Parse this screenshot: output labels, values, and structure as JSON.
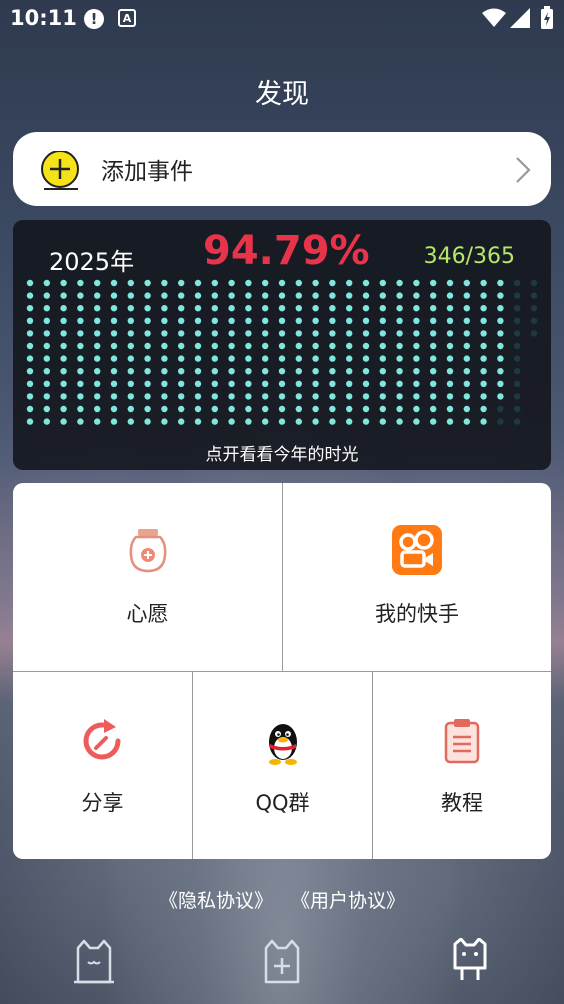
{
  "status_bar": {
    "time": "10:11",
    "icons": [
      "alert-icon",
      "text-a-icon",
      "wifi-icon",
      "signal-icon",
      "battery-icon"
    ]
  },
  "header": {
    "title": "发现"
  },
  "add_event": {
    "label": "添加事件",
    "icon": "plus-circle-icon"
  },
  "year_progress": {
    "year": "2025年",
    "percent": "94.79%",
    "count": "346/365",
    "days_passed": 346,
    "days_total": 365,
    "hint": "点开看看今年的时光",
    "colors": {
      "active": "#7fe7dd",
      "inactive": "#1e3b3a",
      "percent": "#e8344a",
      "count": "#b7e76a"
    }
  },
  "features": [
    {
      "label": "心愿",
      "icon": "wish-jar-icon"
    },
    {
      "label": "我的快手",
      "icon": "kuaishou-icon"
    },
    {
      "label": "分享",
      "icon": "share-icon"
    },
    {
      "label": "QQ群",
      "icon": "qq-penguin-icon"
    },
    {
      "label": "教程",
      "icon": "clipboard-icon"
    }
  ],
  "footer": {
    "privacy": "《隐私协议》",
    "user": "《用户协议》"
  },
  "tabbar": {
    "tabs": [
      {
        "name": "home",
        "icon": "cat-home-icon"
      },
      {
        "name": "add",
        "icon": "cat-add-icon"
      },
      {
        "name": "discover",
        "icon": "cat-face-icon"
      }
    ]
  }
}
